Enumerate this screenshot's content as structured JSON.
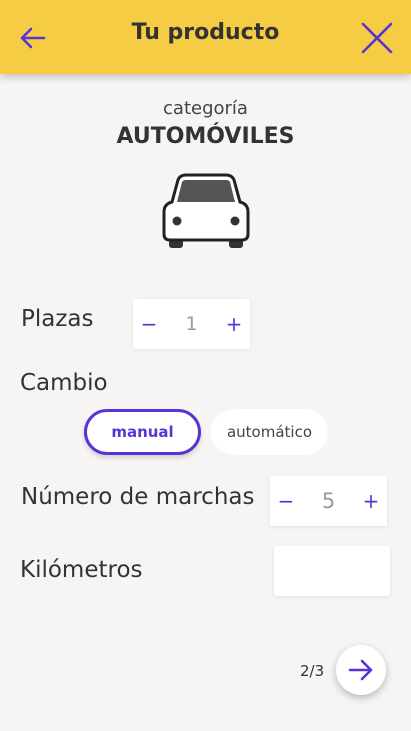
{
  "header": {
    "title": "Tu producto",
    "back_icon": "arrow-left-icon",
    "close_icon": "close-icon",
    "bg_color": "#f7cc45",
    "accent_color": "#5a33d6"
  },
  "category": {
    "label": "categoría",
    "name": "AUTOMÓVILES",
    "icon": "car-icon"
  },
  "plazas": {
    "label": "Plazas",
    "value": "1",
    "minus": "−",
    "plus": "+"
  },
  "cambio": {
    "label": "Cambio",
    "options": [
      "manual",
      "automático"
    ],
    "selected": "manual"
  },
  "marchas": {
    "label": "Número de marchas",
    "value": "5",
    "minus": "−",
    "plus": "+"
  },
  "kilometros": {
    "label": "Kilómetros",
    "value": "",
    "placeholder": ""
  },
  "pager": {
    "text": "2/3",
    "next_icon": "arrow-right-icon"
  }
}
